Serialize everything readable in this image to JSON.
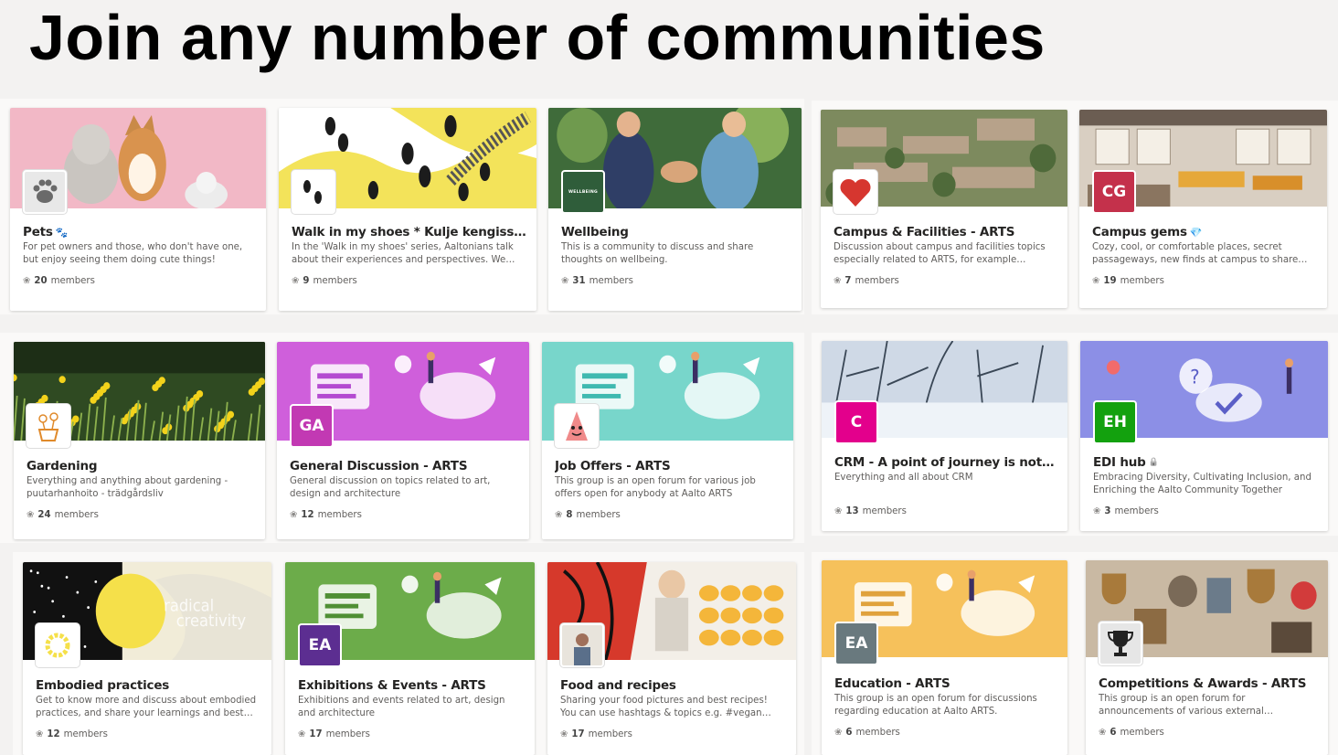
{
  "headline": "Join any number of communities",
  "members_suffix": "members",
  "cards": [
    {
      "title": "Pets",
      "title_icon": "paw-icon",
      "desc": "For pet owners and those, who don't have one, but enjoy seeing them doing cute things!",
      "members": "20",
      "badge": "",
      "badge_color": "#ffffff",
      "banner": "pets"
    },
    {
      "title": "Walk in my shoes * Kulje kengissäni",
      "desc": "In the 'Walk in my shoes' series, Aaltonians talk about their experiences and perspectives. We encourage...",
      "members": "9",
      "badge": "",
      "badge_color": "#ffffff",
      "banner": "shoes"
    },
    {
      "title": "Wellbeing",
      "desc": "This is a community to discuss and share thoughts on wellbeing.",
      "members": "31",
      "badge": "WELLBEING",
      "badge_color": "#2f5d3a",
      "banner": "wellbeing"
    },
    {
      "title": "Campus & Facilities - ARTS",
      "desc": "Discussion about campus and facilities topics especially related to ARTS, for example about...",
      "members": "7",
      "badge": "",
      "badge_color": "#ffffff",
      "banner": "campus"
    },
    {
      "title": "Campus gems",
      "title_icon": "diamond-icon",
      "desc": "Cozy, cool, or comfortable places, secret passageways, new finds at campus to share especial...",
      "members": "19",
      "badge": "CG",
      "badge_color": "#c4314b",
      "banner": "gems"
    },
    {
      "title": "Gardening",
      "desc": "Everything and anything about gardening - puutarhanhoito - trädgårdsliv",
      "members": "24",
      "badge": "",
      "badge_color": "#ffffff",
      "banner": "garden"
    },
    {
      "title": "General Discussion - ARTS",
      "desc": "General discussion on topics related to art, design and architecture",
      "members": "12",
      "badge": "GA",
      "badge_color": "#c239b3",
      "banner": "general"
    },
    {
      "title": "Job Offers - ARTS",
      "desc": "This group is an open forum for various job offers open for anybody at Aalto ARTS",
      "members": "8",
      "badge": "",
      "badge_color": "#ffffff",
      "banner": "jobs"
    },
    {
      "title": "CRM - A point of journey is not to a...",
      "desc": "Everything and all about CRM",
      "members": "13",
      "badge": "C",
      "badge_color": "#e3008c",
      "banner": "crm"
    },
    {
      "title": "EDI hub",
      "title_icon": "lock-icon",
      "desc": "Embracing Diversity, Cultivating Inclusion, and Enriching the Aalto Community Together",
      "members": "3",
      "badge": "EH",
      "badge_color": "#13a10e",
      "banner": "edi"
    },
    {
      "title": "Embodied practices",
      "desc": "Get to know more and discuss about embodied practices, and share your learnings and best everyd...",
      "members": "12",
      "badge": "",
      "badge_color": "#ffffff",
      "banner": "embodied"
    },
    {
      "title": "Exhibitions & Events - ARTS",
      "desc": "Exhibitions and events related to art, design and architecture",
      "members": "17",
      "badge": "EA",
      "badge_color": "#5c2e91",
      "banner": "exhibitions"
    },
    {
      "title": "Food and recipes",
      "desc": "Sharing your food pictures and best recipes! You can use hashtags & topics e.g. #vegan #vegetarian...",
      "members": "17",
      "badge": "",
      "badge_color": "#ffffff",
      "banner": "food"
    },
    {
      "title": "Education - ARTS",
      "desc": "This group is an open forum for discussions regarding education at Aalto ARTS.",
      "members": "6",
      "badge": "EA",
      "badge_color": "#69797e",
      "banner": "education"
    },
    {
      "title": "Competitions & Awards - ARTS",
      "desc": "This group is an open forum for announcements of various external competitions and awards suitable f...",
      "members": "6",
      "badge": "",
      "badge_color": "#ffffff",
      "banner": "awards"
    }
  ]
}
